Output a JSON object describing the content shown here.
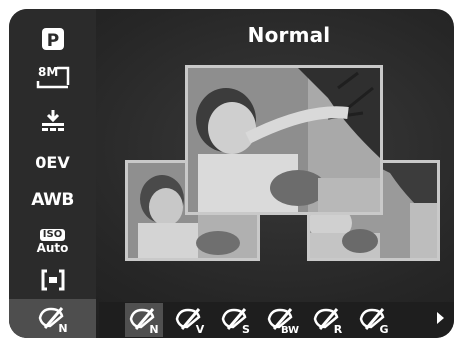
{
  "header": {
    "title": "Normal"
  },
  "sidebar": {
    "items": [
      {
        "icon": "program-mode-icon",
        "label": "P"
      },
      {
        "icon": "image-size-icon",
        "label": "8M"
      },
      {
        "icon": "quality-icon",
        "label": ""
      },
      {
        "icon": "exposure-icon",
        "label": "0EV"
      },
      {
        "icon": "white-balance-icon",
        "label": "AWB"
      },
      {
        "icon": "iso-icon",
        "label": "ISO",
        "sublabel": "Auto"
      },
      {
        "icon": "metering-icon",
        "label": ""
      },
      {
        "icon": "color-effect-icon",
        "label": "N"
      }
    ]
  },
  "effects": [
    {
      "name": "effect-normal",
      "label": "N",
      "selected": true
    },
    {
      "name": "effect-vivid",
      "label": "V",
      "selected": false
    },
    {
      "name": "effect-sepia",
      "label": "S",
      "selected": false
    },
    {
      "name": "effect-bw",
      "label": "BW",
      "selected": false
    },
    {
      "name": "effect-red",
      "label": "R",
      "selected": false
    },
    {
      "name": "effect-green",
      "label": "G",
      "selected": false
    }
  ],
  "colors": {
    "screen": "#262626",
    "sidebar": "#2b2b2b",
    "selected": "#505050",
    "text": "#ffffff",
    "frame": "#c9c9c9"
  }
}
